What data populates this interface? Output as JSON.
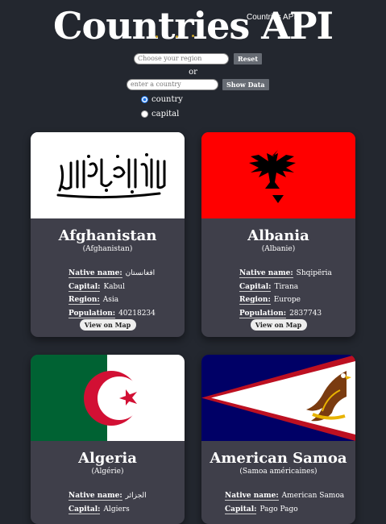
{
  "app": {
    "title": "Countries API",
    "title_overlay": "Countries API"
  },
  "controls": {
    "region_placeholder": "Choose your region",
    "reset_label": "Reset",
    "or_label": "or",
    "country_placeholder": "enter a country",
    "show_label": "Show Data",
    "radio_country": "country",
    "radio_capital": "capital",
    "selected_radio": "country"
  },
  "labels": {
    "native": "Native name:",
    "capital": "Capital:",
    "region": "Region:",
    "population": "Population:",
    "map_button": "View on Map"
  },
  "cards": [
    {
      "name": "Afghanistan",
      "native_paren": "(Afghanistan)",
      "native": "افغانستان",
      "capital": "Kabul",
      "region": "Asia",
      "population": "40218234",
      "flag": "afghanistan"
    },
    {
      "name": "Albania",
      "native_paren": "(Albanie)",
      "native": "Shqipëria",
      "capital": "Tirana",
      "region": "Europe",
      "population": "2837743",
      "flag": "albania"
    },
    {
      "name": "Algeria",
      "native_paren": "(Algérie)",
      "native": "الجزائر",
      "capital": "Algiers",
      "flag": "algeria"
    },
    {
      "name": "American Samoa",
      "native_paren": "(Samoa américaines)",
      "native": "American Samoa",
      "capital": "Pago Pago",
      "flag": "american-samoa"
    }
  ],
  "colors": {
    "background": "#23272f",
    "card": "#3f3f4a",
    "albania_red": "#ff0000",
    "algeria_green": "#006233",
    "samoa_blue": "#000066",
    "samoa_red": "#bd1021"
  }
}
